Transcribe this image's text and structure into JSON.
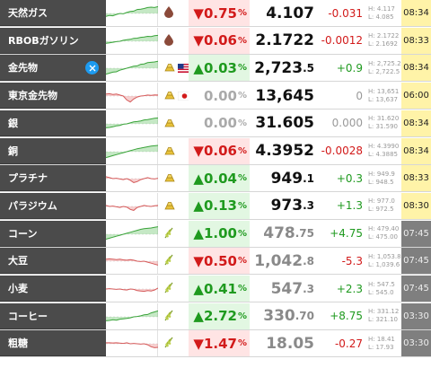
{
  "rows": [
    {
      "name": "天然ガス",
      "pct": "▼0.75",
      "pct_suffix": "%",
      "dir": "down",
      "price_int": "4.107",
      "price_dec": "",
      "change": "-0.031",
      "high": "H: 4.117",
      "low": "L: 4.085",
      "time": "08:34",
      "time_style": "yellow",
      "icons": [
        "drop-icon"
      ],
      "price_gray": false
    },
    {
      "name": "RBOBガソリン",
      "pct": "▼0.06",
      "pct_suffix": "%",
      "dir": "down",
      "price_int": "2.1722",
      "price_dec": "",
      "change": "-0.0012",
      "high": "H: 2.1722",
      "low": "L: 2.1692",
      "time": "08:33",
      "time_style": "yellow",
      "icons": [
        "drop-icon"
      ],
      "price_gray": false
    },
    {
      "name": "金先物",
      "pct": "▲0.03",
      "pct_suffix": "%",
      "dir": "up",
      "price_int": "2,723",
      "price_dec": ".5",
      "change": "+0.9",
      "high": "H: 2,725.2",
      "low": "L: 2,722.5",
      "time": "08:34",
      "time_style": "yellow",
      "icons": [
        "gold-bar-icon",
        "us-flag-icon"
      ],
      "price_gray": false,
      "x_badge": true
    },
    {
      "name": "東京金先物",
      "pct": "0.00",
      "pct_suffix": "%",
      "dir": "flat",
      "price_int": "13,645",
      "price_dec": "",
      "change": "0",
      "high": "H: 13,651",
      "low": "L: 13,637",
      "time": "06:00",
      "time_style": "yellow",
      "icons": [
        "gold-bar-icon",
        "jp-flag-icon"
      ],
      "price_gray": false
    },
    {
      "name": "銀",
      "pct": "0.00",
      "pct_suffix": "%",
      "dir": "flat",
      "price_int": "31.605",
      "price_dec": "",
      "change": "0.000",
      "high": "H: 31.620",
      "low": "L: 31.590",
      "time": "08:34",
      "time_style": "yellow",
      "icons": [
        "gold-bar-icon"
      ],
      "price_gray": false
    },
    {
      "name": "銅",
      "pct": "▼0.06",
      "pct_suffix": "%",
      "dir": "down",
      "price_int": "4.3952",
      "price_dec": "",
      "change": "-0.0028",
      "high": "H: 4.3990",
      "low": "L: 4.3885",
      "time": "08:34",
      "time_style": "yellow",
      "icons": [
        "gold-bar-icon"
      ],
      "price_gray": false
    },
    {
      "name": "プラチナ",
      "pct": "▲0.04",
      "pct_suffix": "%",
      "dir": "up",
      "price_int": "949",
      "price_dec": ".1",
      "change": "+0.3",
      "high": "H: 949.9",
      "low": "L: 948.5",
      "time": "08:33",
      "time_style": "yellow",
      "icons": [
        "gold-bar-icon"
      ],
      "price_gray": false
    },
    {
      "name": "パラジウム",
      "pct": "▲0.13",
      "pct_suffix": "%",
      "dir": "up",
      "price_int": "973",
      "price_dec": ".3",
      "change": "+1.3",
      "high": "H: 977.0",
      "low": "L: 972.5",
      "time": "08:30",
      "time_style": "yellow",
      "icons": [
        "gold-bar-icon"
      ],
      "price_gray": false
    },
    {
      "name": "コーン",
      "pct": "▲1.00",
      "pct_suffix": "%",
      "dir": "up",
      "price_int": "478",
      "price_dec": ".75",
      "change": "+4.75",
      "high": "H: 479.40",
      "low": "L: 475.00",
      "time": "07:45",
      "time_style": "gray",
      "icons": [
        "wheat-icon"
      ],
      "price_gray": true
    },
    {
      "name": "大豆",
      "pct": "▼0.50",
      "pct_suffix": "%",
      "dir": "down",
      "price_int": "1,042",
      "price_dec": ".8",
      "change": "-5.3",
      "high": "H: 1,053.8",
      "low": "L: 1,039.6",
      "time": "07:45",
      "time_style": "gray",
      "icons": [
        "wheat-icon"
      ],
      "price_gray": true
    },
    {
      "name": "小麦",
      "pct": "▲0.41",
      "pct_suffix": "%",
      "dir": "up",
      "price_int": "547",
      "price_dec": ".3",
      "change": "+2.3",
      "high": "H: 547.5",
      "low": "L: 545.0",
      "time": "07:45",
      "time_style": "gray",
      "icons": [
        "wheat-icon"
      ],
      "price_gray": true
    },
    {
      "name": "コーヒー",
      "pct": "▲2.72",
      "pct_suffix": "%",
      "dir": "up",
      "price_int": "330",
      "price_dec": ".70",
      "change": "+8.75",
      "high": "H: 331.12",
      "low": "L: 321.10",
      "time": "03:30",
      "time_style": "gray",
      "icons": [
        "wheat-icon"
      ],
      "price_gray": true
    },
    {
      "name": "粗糖",
      "pct": "▼1.47",
      "pct_suffix": "%",
      "dir": "down",
      "price_int": "18.05",
      "price_dec": "",
      "change": "-0.27",
      "high": "H: 18.41",
      "low": "L: 17.93",
      "time": "03:30",
      "time_style": "gray",
      "icons": [
        "wheat-icon"
      ],
      "price_gray": true
    }
  ],
  "sparklines": [
    {
      "trend": "up",
      "values": [
        0.35,
        0.4,
        0.38,
        0.45,
        0.5,
        0.48,
        0.55,
        0.6,
        0.62,
        0.7,
        0.72,
        0.75,
        0.8,
        0.82,
        0.8,
        0.85
      ]
    },
    {
      "trend": "up",
      "values": [
        0.4,
        0.42,
        0.45,
        0.48,
        0.5,
        0.55,
        0.58,
        0.6,
        0.65,
        0.66,
        0.7,
        0.72,
        0.75,
        0.74,
        0.78,
        0.8
      ]
    },
    {
      "trend": "up",
      "values": [
        0.2,
        0.25,
        0.3,
        0.32,
        0.4,
        0.45,
        0.5,
        0.55,
        0.6,
        0.62,
        0.7,
        0.72,
        0.78,
        0.8,
        0.82,
        0.85
      ]
    },
    {
      "trend": "mixed",
      "values": [
        0.6,
        0.62,
        0.58,
        0.6,
        0.55,
        0.5,
        0.3,
        0.2,
        0.35,
        0.45,
        0.5,
        0.52,
        0.55,
        0.53,
        0.56,
        0.55
      ]
    },
    {
      "trend": "up",
      "values": [
        0.3,
        0.32,
        0.35,
        0.4,
        0.42,
        0.48,
        0.5,
        0.55,
        0.6,
        0.62,
        0.65,
        0.7,
        0.72,
        0.75,
        0.78,
        0.8
      ]
    },
    {
      "trend": "up",
      "values": [
        0.2,
        0.25,
        0.3,
        0.35,
        0.4,
        0.45,
        0.5,
        0.55,
        0.6,
        0.65,
        0.68,
        0.72,
        0.75,
        0.78,
        0.8,
        0.82
      ]
    },
    {
      "trend": "mixed",
      "values": [
        0.6,
        0.55,
        0.5,
        0.52,
        0.48,
        0.45,
        0.5,
        0.42,
        0.3,
        0.35,
        0.45,
        0.5,
        0.55,
        0.5,
        0.48,
        0.52
      ]
    },
    {
      "trend": "mixed",
      "values": [
        0.55,
        0.5,
        0.52,
        0.48,
        0.45,
        0.5,
        0.47,
        0.35,
        0.3,
        0.45,
        0.5,
        0.55,
        0.52,
        0.5,
        0.53,
        0.55
      ]
    },
    {
      "trend": "up",
      "values": [
        0.25,
        0.3,
        0.35,
        0.4,
        0.45,
        0.5,
        0.55,
        0.6,
        0.65,
        0.7,
        0.75,
        0.78,
        0.8,
        0.82,
        0.85,
        0.88
      ]
    },
    {
      "trend": "mixed",
      "values": [
        0.6,
        0.62,
        0.6,
        0.58,
        0.6,
        0.57,
        0.55,
        0.58,
        0.55,
        0.5,
        0.48,
        0.5,
        0.45,
        0.4,
        0.35,
        0.3
      ]
    },
    {
      "trend": "mixed",
      "values": [
        0.5,
        0.52,
        0.5,
        0.48,
        0.5,
        0.47,
        0.45,
        0.5,
        0.48,
        0.42,
        0.4,
        0.38,
        0.42,
        0.4,
        0.45,
        0.55
      ]
    },
    {
      "trend": "up",
      "values": [
        0.3,
        0.32,
        0.35,
        0.33,
        0.38,
        0.4,
        0.42,
        0.45,
        0.5,
        0.52,
        0.55,
        0.6,
        0.62,
        0.7,
        0.75,
        0.8
      ]
    },
    {
      "trend": "mixed",
      "values": [
        0.55,
        0.55,
        0.54,
        0.55,
        0.53,
        0.52,
        0.55,
        0.5,
        0.52,
        0.5,
        0.48,
        0.5,
        0.45,
        0.35,
        0.3,
        0.32
      ]
    }
  ],
  "colors": {
    "up": "#1f9a1f",
    "down": "#d21a1a",
    "flat": "#aaaaaa",
    "up_bg": "#e2f7e2",
    "down_bg": "#ffe4e4",
    "name_bg": "#4b4b4b",
    "time_yellow": "#fff3a8",
    "time_gray": "#7f7f7f",
    "x_badge": "#1d9bf0"
  }
}
